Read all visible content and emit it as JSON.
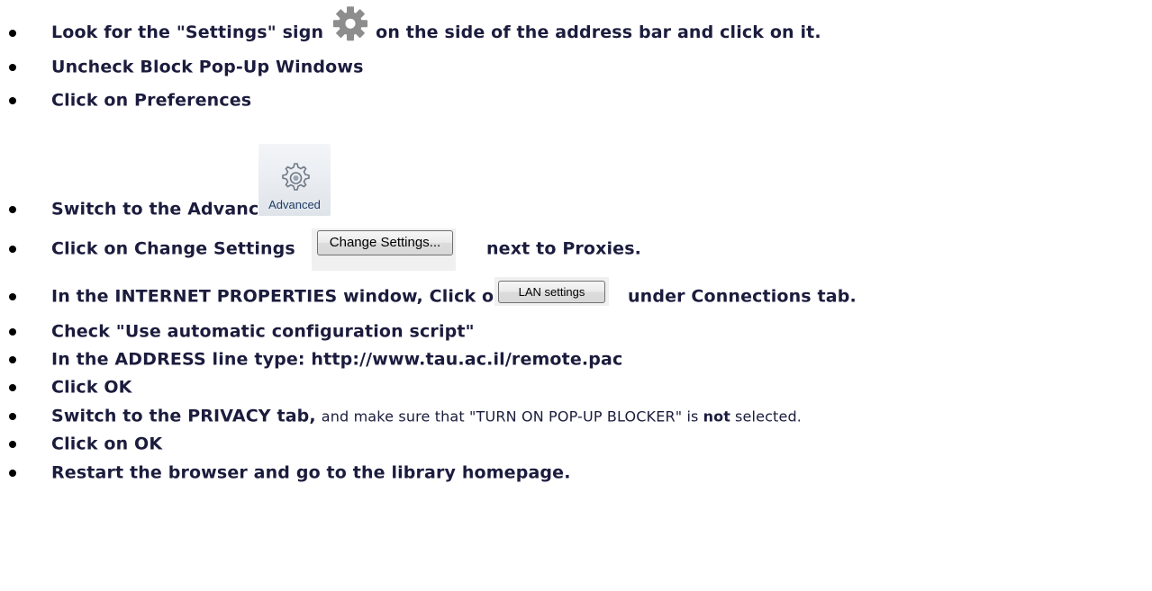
{
  "items": [
    {
      "before": "Look for the \"Settings\" sign",
      "after": "on the side of the address bar and click on it."
    },
    {
      "text": "Uncheck Block Pop-Up Windows"
    },
    {
      "text": "Click on Preferences"
    },
    {
      "text": "Switch to the Advanced tab"
    },
    {
      "before": "Click on Change Settings",
      "after": "next to Proxies."
    },
    {
      "before": "In the INTERNET PROPERTIES window, Click on",
      "after": "under Connections tab."
    },
    {
      "text": "Check \"Use automatic configuration script\""
    },
    {
      "text": "In the ADDRESS line type: http://www.tau.ac.il/remote.pac"
    },
    {
      "text": "Click OK"
    },
    {
      "part1": "Switch to the PRIVACY tab,",
      "part2": "and make sure that \"TURN ON POP-UP BLOCKER\" is",
      "part3": "not",
      "part4": "selected."
    },
    {
      "text": "Click on OK"
    },
    {
      "text": "Restart the browser and go to the library homepage."
    }
  ],
  "buttons": {
    "advanced_label": "Advanced",
    "change_settings_label": "Change Settings...",
    "lan_settings_label": "LAN settings"
  },
  "icons": {
    "settings": "gear-icon",
    "advanced": "gears-icon"
  },
  "colors": {
    "text": "#1b1c3d",
    "advanced_label": "#1e3d66"
  }
}
